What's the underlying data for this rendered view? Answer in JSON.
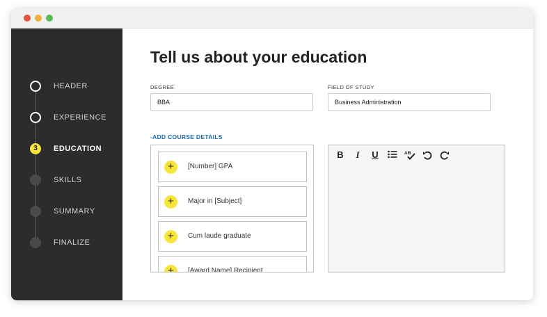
{
  "sidebar": {
    "steps": [
      {
        "label": "HEADER",
        "state": "done"
      },
      {
        "label": "EXPERIENCE",
        "state": "done"
      },
      {
        "label": "EDUCATION",
        "state": "current",
        "number": "3"
      },
      {
        "label": "SKILLS",
        "state": "pending"
      },
      {
        "label": "SUMMARY",
        "state": "pending"
      },
      {
        "label": "FINALIZE",
        "state": "pending"
      }
    ]
  },
  "main": {
    "title": "Tell us about your education",
    "degree": {
      "label": "DEGREE",
      "value": "BBA"
    },
    "field_of_study": {
      "label": "FIELD OF STUDY",
      "value": "Business Administration"
    },
    "add_course_link": "-ADD COURSE DETAILS",
    "suggestions": [
      "[Number] GPA",
      "Major in [Subject]",
      "Cum laude graduate",
      "[Award Name] Recipient"
    ],
    "editor_toolbar": [
      "bold-icon",
      "italic-icon",
      "underline-icon",
      "bulleted-list-icon",
      "spellcheck-icon",
      "undo-icon",
      "redo-icon"
    ]
  },
  "colors": {
    "sidebar_bg": "#2c2c2c",
    "accent_yellow": "#f8e53a",
    "link_blue": "#1b6ab1"
  }
}
